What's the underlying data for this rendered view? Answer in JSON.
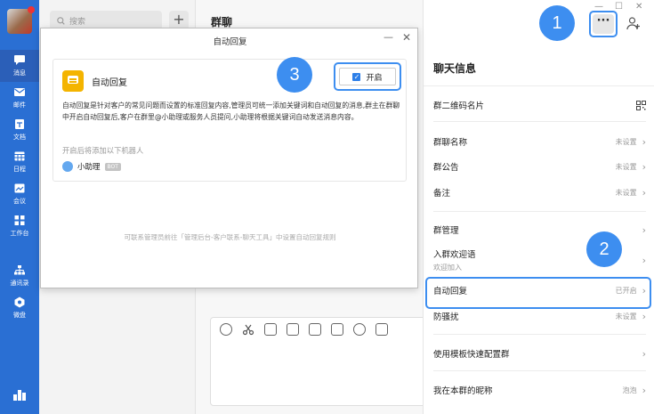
{
  "nav": {
    "items": [
      {
        "label": "消息",
        "icon": "chat-bubble-icon"
      },
      {
        "label": "邮件",
        "icon": "mail-icon"
      },
      {
        "label": "文档",
        "icon": "document-icon"
      },
      {
        "label": "日程",
        "icon": "calendar-icon"
      },
      {
        "label": "会议",
        "icon": "meeting-icon"
      },
      {
        "label": "工作台",
        "icon": "workbench-icon"
      },
      {
        "label": "通讯录",
        "icon": "contacts-icon"
      },
      {
        "label": "微盘",
        "icon": "drive-icon"
      }
    ]
  },
  "search": {
    "placeholder": "搜索"
  },
  "chat": {
    "title": "群聊"
  },
  "dialog": {
    "title": "自动回复",
    "card_title": "自动回复",
    "toggle_label": "开启",
    "description": "自动回复是针对客户的常见问题而设置的标准回复内容,管理员可统一添加关键词和自动回复的消息,群主在群聊中开启自动回复后,客户在群里@小助理或服务人员提问,小助理将根据关键词自动发送消息内容。",
    "robot_hint": "开启后将添加以下机器人",
    "robot_name": "小助理",
    "robot_tag": "BOT",
    "footer": "可联系管理员前往「管理后台-客户联系-聊天工具」中设置自动回复规则"
  },
  "panel": {
    "title": "聊天信息",
    "rows": {
      "qr": {
        "label": "群二维码名片"
      },
      "name": {
        "label": "群聊名称",
        "value": "未设置"
      },
      "notice": {
        "label": "群公告",
        "value": "未设置"
      },
      "remark": {
        "label": "备注",
        "value": "未设置"
      },
      "manage": {
        "label": "群管理"
      },
      "welcome": {
        "label": "入群欢迎语",
        "sub": "欢迎加入"
      },
      "autoreply": {
        "label": "自动回复",
        "value": "已开启"
      },
      "antiharass": {
        "label": "防骚扰",
        "value": "未设置"
      },
      "template": {
        "label": "使用模板快速配置群"
      },
      "nickname": {
        "label": "我在本群的昵称",
        "value": "泡泡"
      }
    }
  },
  "steps": {
    "one": "1",
    "two": "2",
    "three": "3"
  },
  "colors": {
    "nav_blue": "#2a6fd3",
    "accent": "#3d8ef0",
    "icon_yellow": "#f4b400"
  }
}
